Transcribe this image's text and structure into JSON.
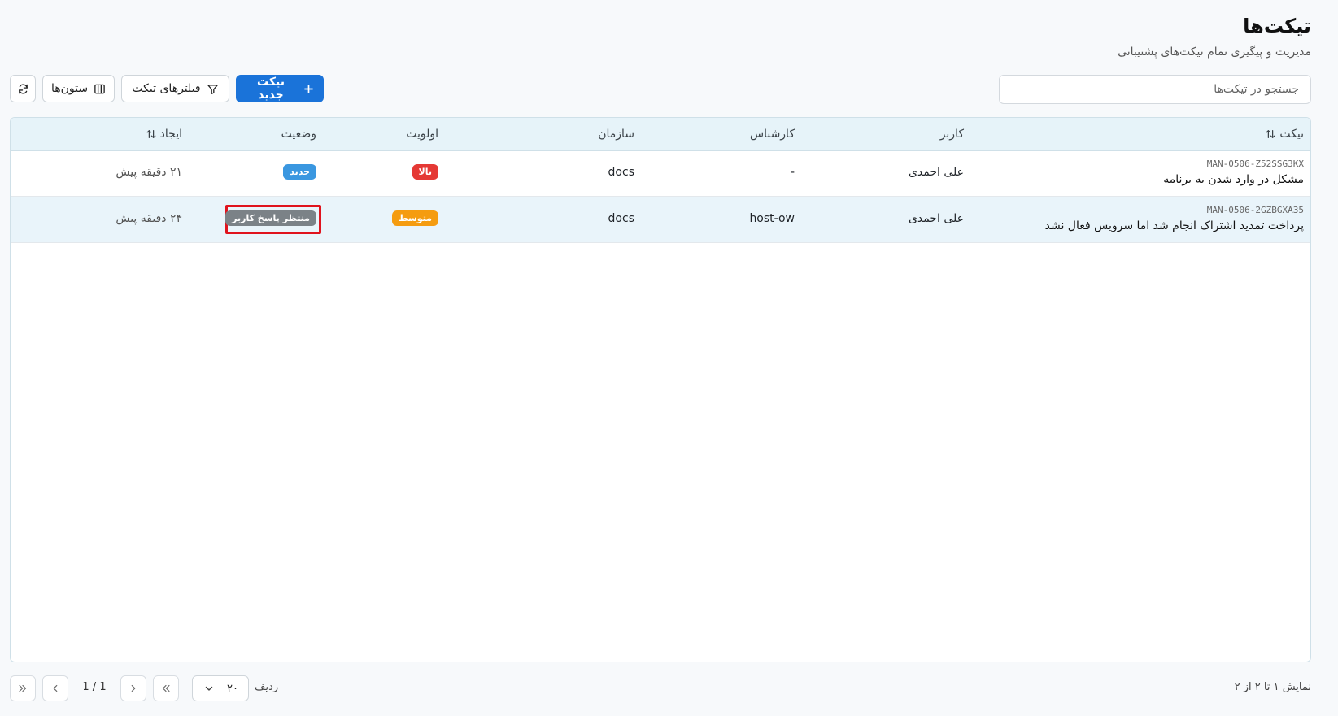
{
  "header": {
    "title": "تیکت‌ها",
    "subtitle": "مدیریت و پیگیری تمام تیکت‌های پشتیبانی"
  },
  "search": {
    "placeholder": "جستجو در تیکت‌ها",
    "value": ""
  },
  "toolbar": {
    "new_ticket_label": "تیکت جدید",
    "filters_label": "فیلترهای تیکت",
    "columns_label": "ستون‌ها"
  },
  "table": {
    "columns": {
      "ticket": "تیکت",
      "user": "کاربر",
      "agent": "کارشناس",
      "organization": "سازمان",
      "priority": "اولویت",
      "status": "وضعیت",
      "created": "ایجاد"
    },
    "rows": [
      {
        "id": "MAN-0506-Z52SSG3KX",
        "title": "مشکل در وارد شدن به برنامه",
        "user": "علی احمدی",
        "agent": "-",
        "organization": "docs",
        "priority": "بالا",
        "status": "جدید",
        "created": "۲۱ دقیقه پیش"
      },
      {
        "id": "MAN-0506-2GZBGXA35",
        "title": "پرداخت تمدید اشتراک انجام شد اما سرویس فعال نشد",
        "user": "علی احمدی",
        "agent": "host-ow",
        "organization": "docs",
        "priority": "متوسط",
        "status": "منتظر پاسخ کاربر",
        "created": "۲۴ دقیقه پیش"
      }
    ]
  },
  "pagination": {
    "summary": "نمایش ۱ تا ۲ از ۲",
    "rows_label": "ردیف",
    "page_size": "۲۰",
    "page_indicator": "1 / 1"
  },
  "colors": {
    "primary": "#1a73d9",
    "priority_high": "#e53935",
    "priority_medium": "#f59c10",
    "status_new": "#3a97e0",
    "status_waiting": "#7b8287",
    "highlight": "#e0131d"
  },
  "icons": {
    "new_ticket": "plus-icon",
    "filters": "filter-icon",
    "columns": "columns-icon",
    "refresh": "refresh-icon",
    "sort": "sort-icon",
    "rows_select": "chevron-down-icon",
    "first_page": "double-chevron-left-icon",
    "prev_page": "chevron-left-icon",
    "next_page": "chevron-right-icon",
    "last_page": "double-chevron-right-icon"
  }
}
